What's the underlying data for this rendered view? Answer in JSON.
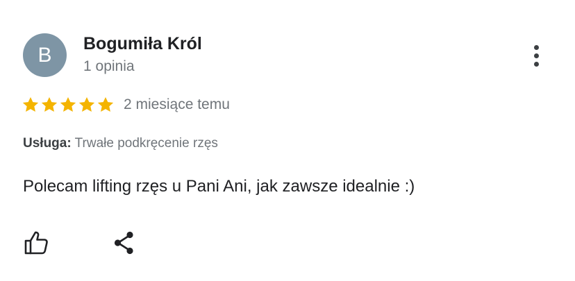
{
  "review": {
    "author": {
      "avatar_letter": "B",
      "avatar_color": "#7e95a5",
      "name": "Bogumiła Król",
      "meta": "1 opinia"
    },
    "rating": {
      "value": 5,
      "max": 5,
      "star_color": "#f4b400"
    },
    "time": "2 miesiące temu",
    "service": {
      "label": "Usługa:",
      "value": "Trwałe podkręcenie rzęs"
    },
    "text": "Polecam lifting rzęs u Pani Ani, jak zawsze idealnie :)",
    "actions": {
      "like_icon": "thumb-up-icon",
      "share_icon": "share-icon",
      "more_icon": "more-vert-icon"
    }
  }
}
